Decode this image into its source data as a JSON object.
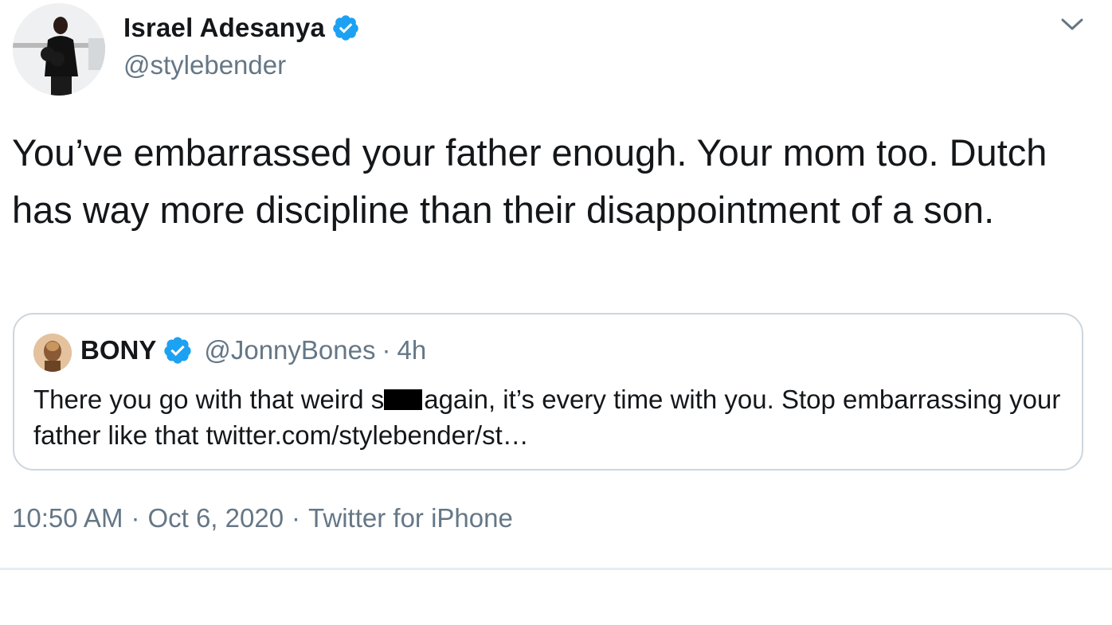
{
  "author": {
    "display_name": "Israel Adesanya",
    "handle": "@stylebender",
    "verified_icon": "verified-badge-icon",
    "avatar": "avatar-photo"
  },
  "menu": {
    "icon": "chevron-down-icon"
  },
  "tweet": {
    "text": "You’ve embarrassed your father enough. Your mom too. Dutch has way more discipline than their disappointment of a son."
  },
  "quote": {
    "display_name": "BONY",
    "handle": "@JonnyBones",
    "separator": "·",
    "time": "4h",
    "text_before": "There you go with that weird s",
    "text_after": "again, it’s every time with you. Stop embarrassing your father like that ",
    "link": "twitter.com/stylebender/st…"
  },
  "meta": {
    "time": "10:50 AM",
    "separator1": "·",
    "date": "Oct 6, 2020",
    "separator2": "·",
    "source": "Twitter for iPhone"
  },
  "colors": {
    "verified_blue": "#1da1f2",
    "secondary_text": "#657786",
    "border": "#ccd6dd"
  }
}
